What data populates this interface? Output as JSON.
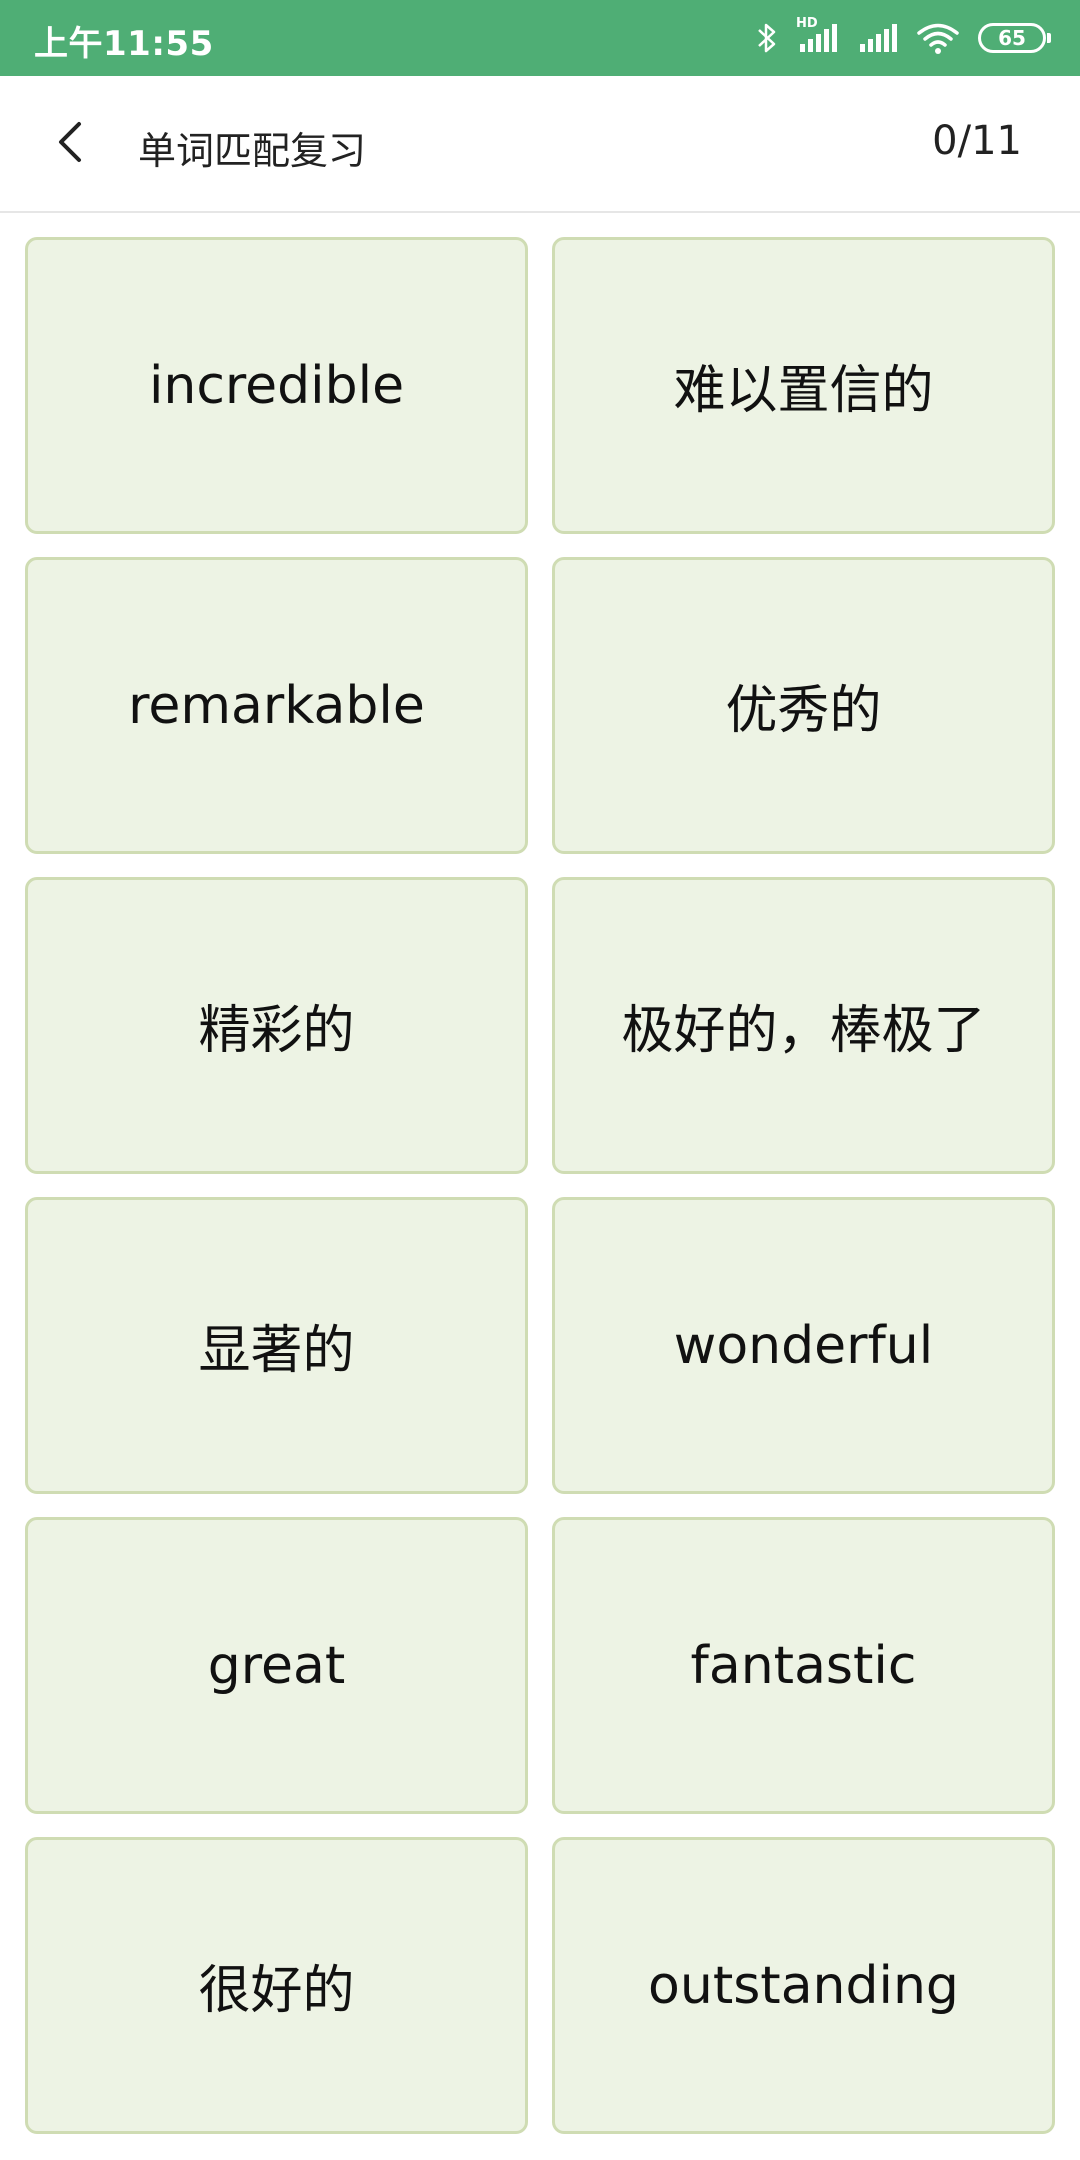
{
  "status_bar": {
    "time": "上午11:55",
    "battery": "65",
    "network_label": "HD",
    "icons": [
      "bluetooth-icon",
      "signal-hd-icon",
      "signal-icon",
      "wifi-icon",
      "battery-icon"
    ],
    "background_color": "#4fae75"
  },
  "header": {
    "back_icon": "chevron-left-icon",
    "title": "单词匹配复习",
    "progress": "0/11"
  },
  "cards": [
    {
      "text": "incredible"
    },
    {
      "text": "难以置信的"
    },
    {
      "text": "remarkable"
    },
    {
      "text": "优秀的"
    },
    {
      "text": "精彩的"
    },
    {
      "text": "极好的，棒极了"
    },
    {
      "text": "显著的"
    },
    {
      "text": "wonderful"
    },
    {
      "text": "great"
    },
    {
      "text": "fantastic"
    },
    {
      "text": "很好的"
    },
    {
      "text": "outstanding"
    }
  ],
  "colors": {
    "card_background": "#edf3e4",
    "card_border": "#cfdcb3"
  }
}
